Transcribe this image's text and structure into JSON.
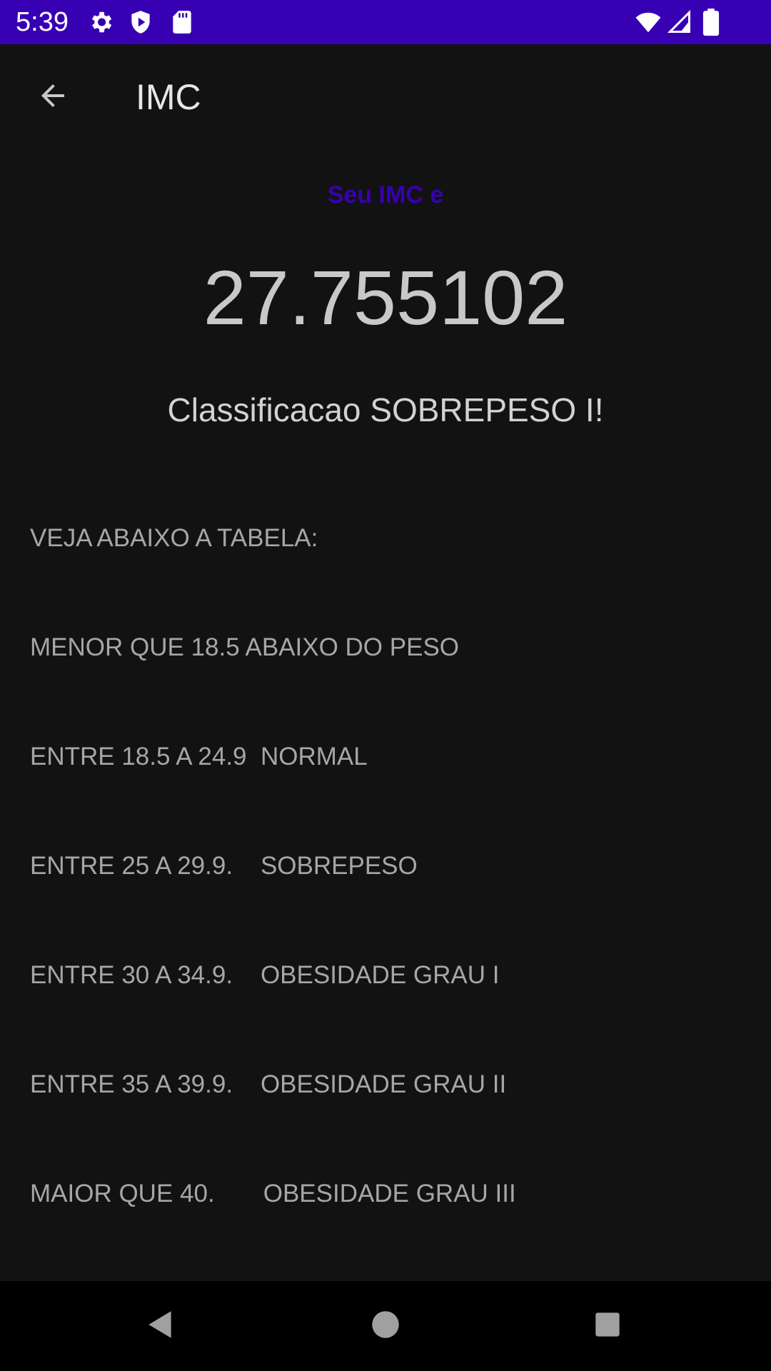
{
  "status_bar": {
    "time": "5:39",
    "left_icons": [
      "settings-icon",
      "shield-play-icon",
      "sd-card-icon"
    ],
    "right_icons": [
      "wifi-icon",
      "signal-icon",
      "battery-icon"
    ],
    "background_color": "#3700B3"
  },
  "app_bar": {
    "title": "IMC",
    "back_icon": "arrow-back-icon"
  },
  "result": {
    "subtitle": "Seu IMC e",
    "value": "27.755102",
    "classification": "Classificacao SOBREPESO I!"
  },
  "table": {
    "lines": [
      "VEJA ABAIXO A TABELA:",
      "MENOR QUE 18.5 ABAIXO DO PESO",
      "ENTRE 18.5 A 24.9  NORMAL",
      "ENTRE 25 A 29.9.    SOBREPESO",
      "ENTRE 30 A 34.9.    OBESIDADE GRAU I",
      "ENTRE 35 A 39.9.    OBESIDADE GRAU II",
      "MAIOR QUE 40.       OBESIDADE GRAU III"
    ]
  },
  "nav_bar": {
    "buttons": [
      "back-triangle-icon",
      "home-circle-icon",
      "recents-square-icon"
    ]
  },
  "colors": {
    "accent": "#3700B3",
    "background": "#121212"
  }
}
